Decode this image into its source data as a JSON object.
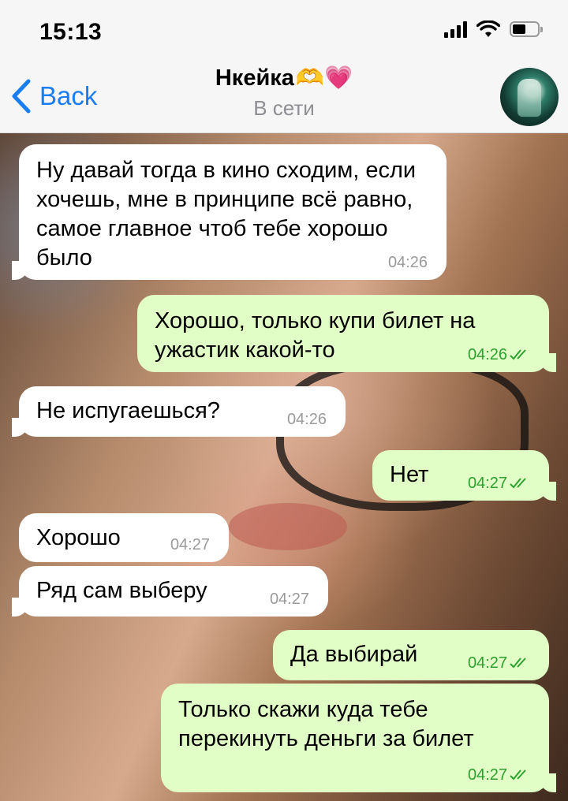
{
  "status_bar": {
    "time": "15:13"
  },
  "header": {
    "back_label": "Back",
    "contact_name": "Нкейка",
    "contact_emoji": "🫶💗",
    "status": "В сети"
  },
  "messages": [
    {
      "direction": "in",
      "text": "Ну давай тогда в кино сходим, если хочешь, мне в принципе всё равно, самое главное чтоб тебе хорошо было",
      "time": "04:26"
    },
    {
      "direction": "out",
      "text": "Хорошо, только купи билет на ужастик какой-то",
      "time": "04:26",
      "read": true
    },
    {
      "direction": "in",
      "text": "Не испугаешься?",
      "time": "04:26"
    },
    {
      "direction": "out",
      "text": "Нет",
      "time": "04:27",
      "read": true
    },
    {
      "direction": "in",
      "text": "Хорошо",
      "time": "04:27"
    },
    {
      "direction": "in",
      "text": "Ряд сам выберу",
      "time": "04:27"
    },
    {
      "direction": "out",
      "text": "Да выбирай",
      "time": "04:27",
      "read": true
    },
    {
      "direction": "out",
      "text": "Только скажи куда тебе перекинуть деньги за билет",
      "time": "04:27",
      "read": true
    }
  ],
  "colors": {
    "accent": "#1a7ef2",
    "incoming_bubble": "#ffffff",
    "outgoing_bubble": "#e1fec6",
    "outgoing_meta": "#2ca12f"
  }
}
